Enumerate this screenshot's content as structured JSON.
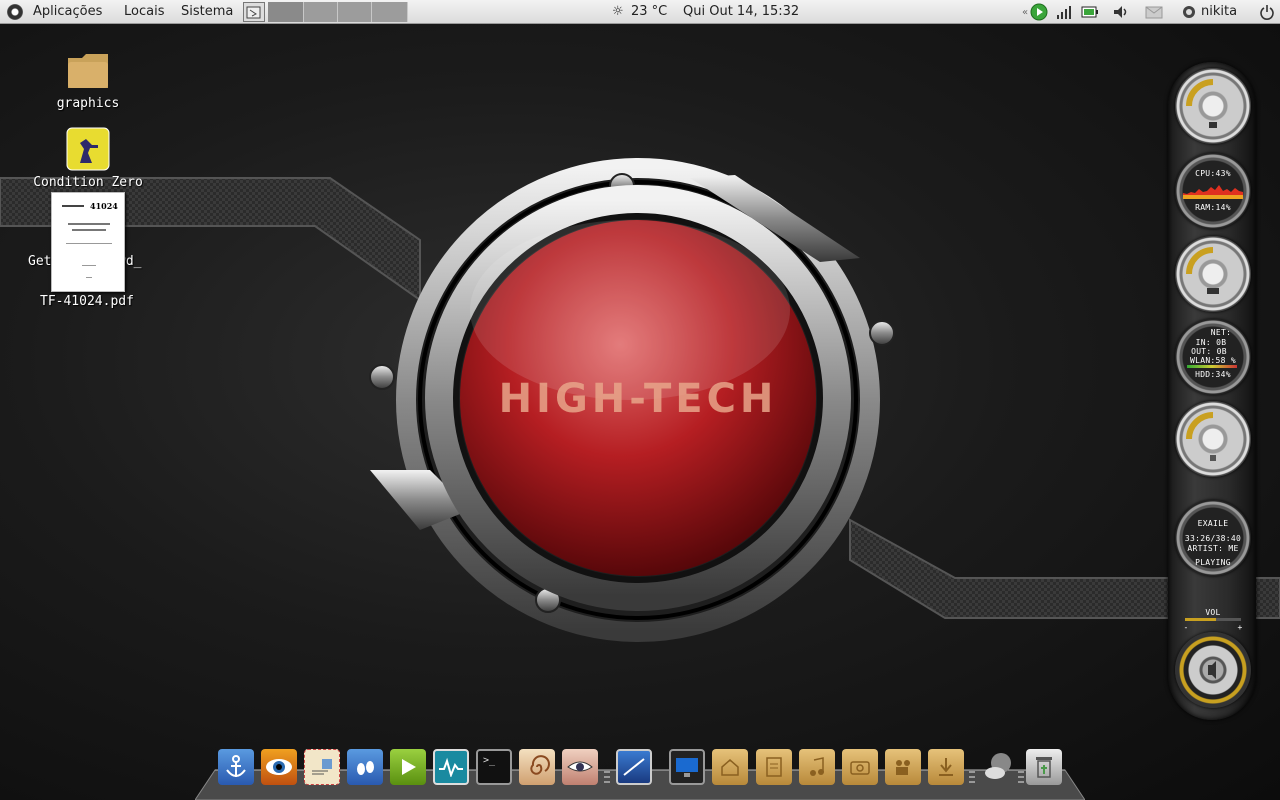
{
  "top_panel": {
    "menus": [
      "Aplicações",
      "Locais",
      "Sistema"
    ],
    "weather": "23 °C",
    "clock": "Qui Out 14, 15:32",
    "user": "nikita"
  },
  "desktop_icons": [
    {
      "label": "graphics"
    },
    {
      "label": "Condition Zero"
    },
    {
      "label": "Get",
      "label_tail": "wd_"
    },
    {
      "label": "TF-41024.pdf",
      "doc_number": "41024"
    }
  ],
  "wallpaper": {
    "text": "HIGH-TECH",
    "accent": "#c8191f"
  },
  "gadgets": {
    "cpu": "CPU:43%",
    "ram": "RAM:14%",
    "net_title": "NET:",
    "net_in": "IN: 0B",
    "net_out": "OUT: 0B",
    "wlan": "WLAN:58 %",
    "hdd": "HDD:34%",
    "player_name": "EXAILE",
    "player_time": "33:26/38:40",
    "player_artist": "ARTIST: ME",
    "player_status": "PLAYING",
    "vol_label": "VOL",
    "vol_minus": "-",
    "vol_plus": "+"
  },
  "dock": {
    "items": [
      "anchor-icon",
      "eye-icon",
      "mail-icon",
      "footprints-icon",
      "play-icon",
      "monitor-icon",
      "terminal-icon",
      "shell-icon",
      "eye-drawing-icon",
      "screenshot-icon",
      "display-icon",
      "home-folder-icon",
      "documents-folder-icon",
      "music-folder-icon",
      "pictures-folder-icon",
      "videos-folder-icon",
      "downloads-folder-icon",
      "weather-icon",
      "trash-icon"
    ]
  }
}
